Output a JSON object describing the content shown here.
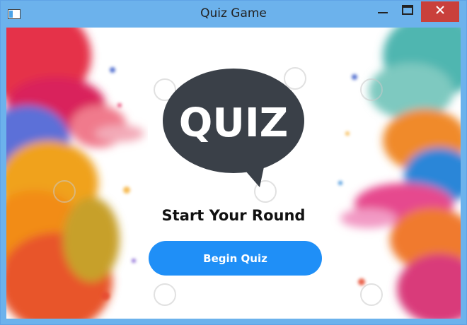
{
  "window": {
    "title": "Quiz Game"
  },
  "icons": {
    "app": "app-window-icon",
    "minimize": "minimize-icon",
    "maximize": "maximize-icon",
    "close": "close-icon"
  },
  "logo": {
    "text": "QUIZ",
    "color": "#3a4048"
  },
  "main": {
    "heading": "Start Your Round",
    "begin_label": "Begin Quiz"
  },
  "colors": {
    "titlebar": "#6cb2ec",
    "accent_button": "#1f8ff7",
    "close_button": "#c9403b"
  }
}
